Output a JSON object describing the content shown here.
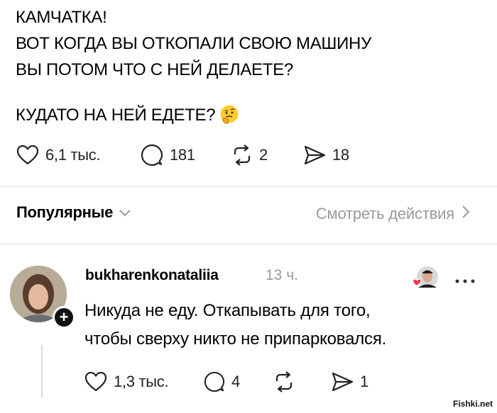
{
  "post": {
    "lines": [
      "КАМЧАТКА!",
      "ВОТ КОГДА ВЫ ОТКОПАЛИ СВОЮ МАШИНУ",
      "ВЫ ПОТОМ ЧТО С НЕЙ ДЕЛАЕТЕ?",
      "КУДАТО НА НЕЙ ЕДЕТЕ?"
    ],
    "emoji_icon": "thinking-face-emoji",
    "actions": {
      "likes": "6,1 тыс.",
      "comments": "181",
      "reposts": "2",
      "shares": "18"
    }
  },
  "replies_header": {
    "sort_label": "Популярные",
    "view_activity_label": "Смотреть действия"
  },
  "comment": {
    "username": "bukharenkonataliia",
    "time": "13 ч.",
    "lines": [
      "Никуда не еду. Откапывать для того,",
      "чтобы сверху никто не припарковался."
    ],
    "actions": {
      "likes": "1,3 тыс.",
      "comments": "4",
      "shares": "1"
    },
    "follow_badge": "+"
  },
  "watermark": "Fishki.net",
  "colors": {
    "text": "#000000",
    "muted": "#9a9a9a",
    "divider": "#e3e3e3",
    "heart_red": "#ff3040"
  }
}
